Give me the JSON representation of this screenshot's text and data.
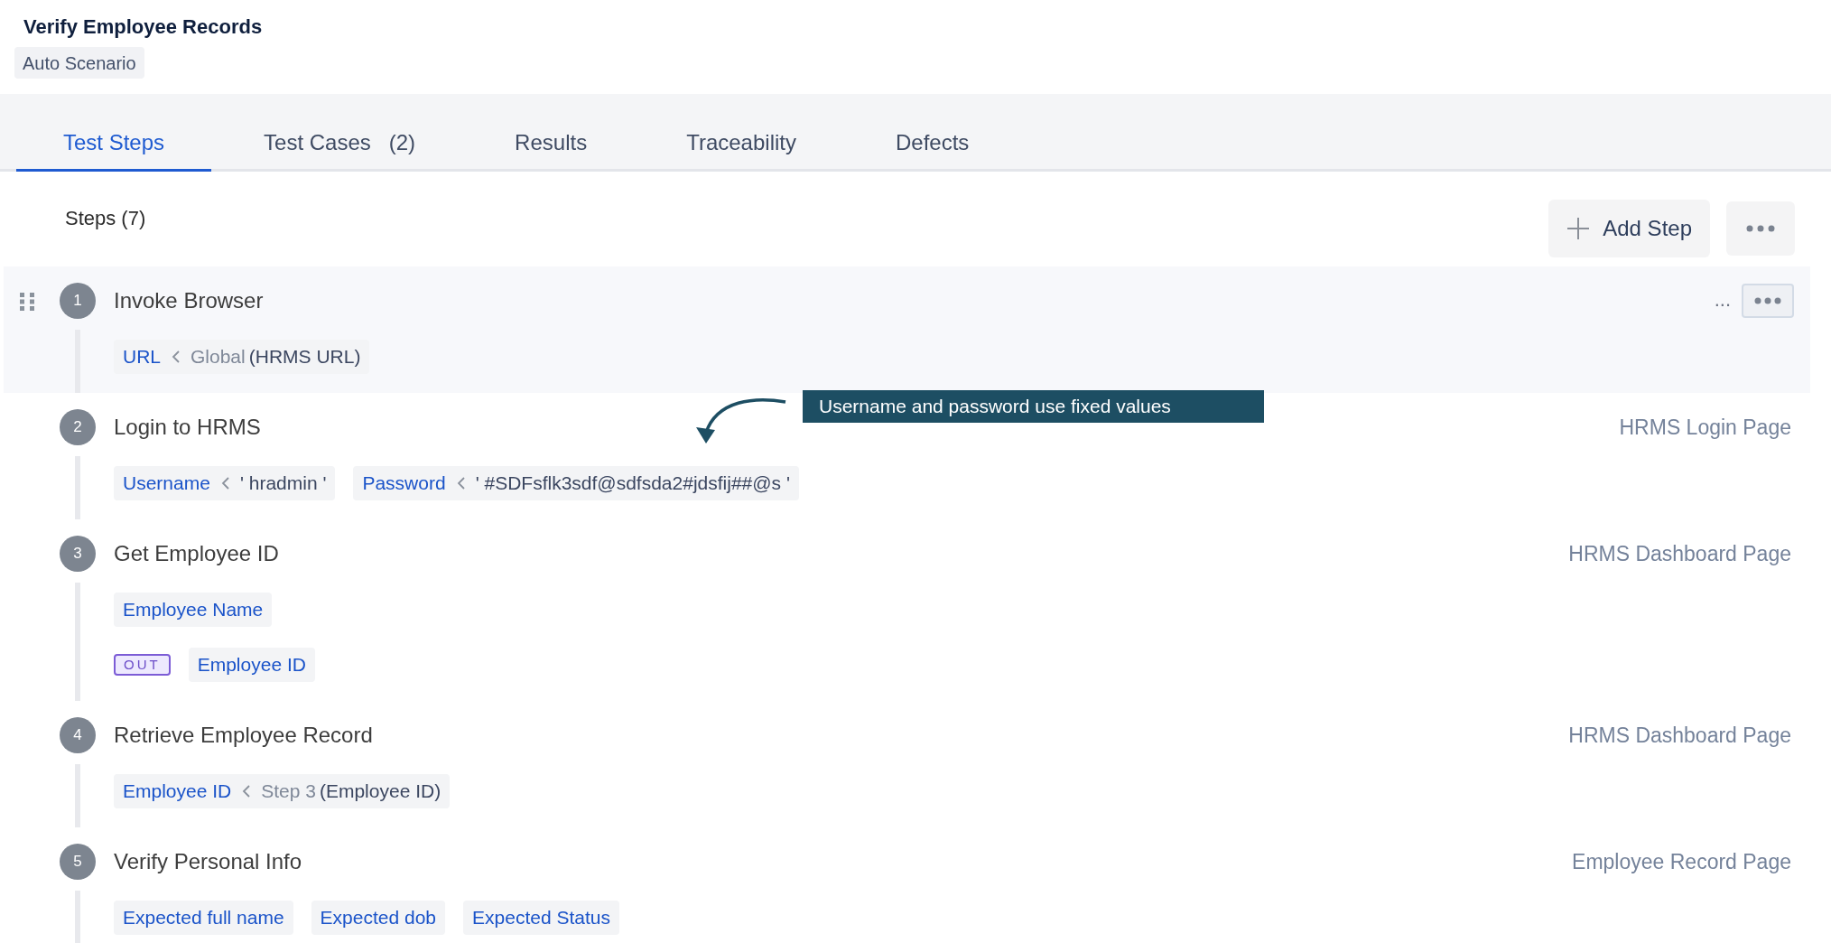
{
  "header": {
    "title": "Verify Employee Records",
    "badge": "Auto Scenario"
  },
  "tabs": [
    {
      "label": "Test Steps",
      "selected": true
    },
    {
      "label": "Test Cases",
      "count": "(2)",
      "selected": false
    },
    {
      "label": "Results",
      "selected": false
    },
    {
      "label": "Traceability",
      "selected": false
    },
    {
      "label": "Defects",
      "selected": false
    }
  ],
  "steps_label": "Steps (7)",
  "add_button": "Add Step",
  "steps": [
    {
      "number": "1",
      "title": "Invoke Browser",
      "highlighted": true,
      "overflow": "...",
      "rows": [
        [
          {
            "kind": "param",
            "name": "URL",
            "source": "Global",
            "value": "(HRMS URL)"
          }
        ]
      ]
    },
    {
      "number": "2",
      "title": "Login to HRMS",
      "highlighted": false,
      "page": "HRMS Login Page",
      "rows": [
        [
          {
            "kind": "param",
            "name": "Username",
            "value": "' hradmin '"
          },
          {
            "kind": "param",
            "name": "Password",
            "value": "' #SDFsflk3sdf@sdfsda2#jdsfij##@s '"
          }
        ]
      ]
    },
    {
      "number": "3",
      "title": "Get Employee ID",
      "highlighted": false,
      "page": "HRMS Dashboard Page",
      "rows": [
        [
          {
            "kind": "param",
            "name": "Employee Name"
          }
        ],
        [
          {
            "kind": "out",
            "tag": "OUT"
          },
          {
            "kind": "param",
            "name": "Employee ID"
          }
        ]
      ]
    },
    {
      "number": "4",
      "title": "Retrieve Employee Record",
      "highlighted": false,
      "page": "HRMS Dashboard Page",
      "rows": [
        [
          {
            "kind": "param",
            "name": "Employee ID",
            "source": "Step 3",
            "value": "(Employee ID)"
          }
        ]
      ]
    },
    {
      "number": "5",
      "title": "Verify Personal Info",
      "highlighted": false,
      "page": "Employee Record Page",
      "rows": [
        [
          {
            "kind": "param",
            "name": "Expected full name"
          },
          {
            "kind": "param",
            "name": "Expected dob"
          },
          {
            "kind": "param",
            "name": "Expected Status"
          }
        ]
      ]
    }
  ],
  "annotation": {
    "text": "Username and password use fixed values"
  }
}
